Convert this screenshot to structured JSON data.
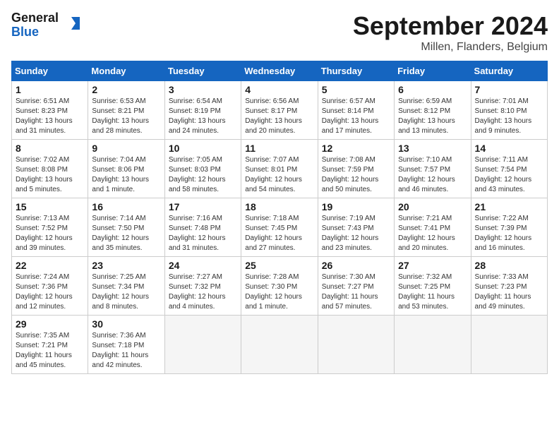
{
  "header": {
    "logo_line1": "General",
    "logo_line2": "Blue",
    "month": "September 2024",
    "location": "Millen, Flanders, Belgium"
  },
  "weekdays": [
    "Sunday",
    "Monday",
    "Tuesday",
    "Wednesday",
    "Thursday",
    "Friday",
    "Saturday"
  ],
  "weeks": [
    [
      {
        "day": "1",
        "info": "Sunrise: 6:51 AM\nSunset: 8:23 PM\nDaylight: 13 hours\nand 31 minutes."
      },
      {
        "day": "2",
        "info": "Sunrise: 6:53 AM\nSunset: 8:21 PM\nDaylight: 13 hours\nand 28 minutes."
      },
      {
        "day": "3",
        "info": "Sunrise: 6:54 AM\nSunset: 8:19 PM\nDaylight: 13 hours\nand 24 minutes."
      },
      {
        "day": "4",
        "info": "Sunrise: 6:56 AM\nSunset: 8:17 PM\nDaylight: 13 hours\nand 20 minutes."
      },
      {
        "day": "5",
        "info": "Sunrise: 6:57 AM\nSunset: 8:14 PM\nDaylight: 13 hours\nand 17 minutes."
      },
      {
        "day": "6",
        "info": "Sunrise: 6:59 AM\nSunset: 8:12 PM\nDaylight: 13 hours\nand 13 minutes."
      },
      {
        "day": "7",
        "info": "Sunrise: 7:01 AM\nSunset: 8:10 PM\nDaylight: 13 hours\nand 9 minutes."
      }
    ],
    [
      {
        "day": "8",
        "info": "Sunrise: 7:02 AM\nSunset: 8:08 PM\nDaylight: 13 hours\nand 5 minutes."
      },
      {
        "day": "9",
        "info": "Sunrise: 7:04 AM\nSunset: 8:06 PM\nDaylight: 13 hours\nand 1 minute."
      },
      {
        "day": "10",
        "info": "Sunrise: 7:05 AM\nSunset: 8:03 PM\nDaylight: 12 hours\nand 58 minutes."
      },
      {
        "day": "11",
        "info": "Sunrise: 7:07 AM\nSunset: 8:01 PM\nDaylight: 12 hours\nand 54 minutes."
      },
      {
        "day": "12",
        "info": "Sunrise: 7:08 AM\nSunset: 7:59 PM\nDaylight: 12 hours\nand 50 minutes."
      },
      {
        "day": "13",
        "info": "Sunrise: 7:10 AM\nSunset: 7:57 PM\nDaylight: 12 hours\nand 46 minutes."
      },
      {
        "day": "14",
        "info": "Sunrise: 7:11 AM\nSunset: 7:54 PM\nDaylight: 12 hours\nand 43 minutes."
      }
    ],
    [
      {
        "day": "15",
        "info": "Sunrise: 7:13 AM\nSunset: 7:52 PM\nDaylight: 12 hours\nand 39 minutes."
      },
      {
        "day": "16",
        "info": "Sunrise: 7:14 AM\nSunset: 7:50 PM\nDaylight: 12 hours\nand 35 minutes."
      },
      {
        "day": "17",
        "info": "Sunrise: 7:16 AM\nSunset: 7:48 PM\nDaylight: 12 hours\nand 31 minutes."
      },
      {
        "day": "18",
        "info": "Sunrise: 7:18 AM\nSunset: 7:45 PM\nDaylight: 12 hours\nand 27 minutes."
      },
      {
        "day": "19",
        "info": "Sunrise: 7:19 AM\nSunset: 7:43 PM\nDaylight: 12 hours\nand 23 minutes."
      },
      {
        "day": "20",
        "info": "Sunrise: 7:21 AM\nSunset: 7:41 PM\nDaylight: 12 hours\nand 20 minutes."
      },
      {
        "day": "21",
        "info": "Sunrise: 7:22 AM\nSunset: 7:39 PM\nDaylight: 12 hours\nand 16 minutes."
      }
    ],
    [
      {
        "day": "22",
        "info": "Sunrise: 7:24 AM\nSunset: 7:36 PM\nDaylight: 12 hours\nand 12 minutes."
      },
      {
        "day": "23",
        "info": "Sunrise: 7:25 AM\nSunset: 7:34 PM\nDaylight: 12 hours\nand 8 minutes."
      },
      {
        "day": "24",
        "info": "Sunrise: 7:27 AM\nSunset: 7:32 PM\nDaylight: 12 hours\nand 4 minutes."
      },
      {
        "day": "25",
        "info": "Sunrise: 7:28 AM\nSunset: 7:30 PM\nDaylight: 12 hours\nand 1 minute."
      },
      {
        "day": "26",
        "info": "Sunrise: 7:30 AM\nSunset: 7:27 PM\nDaylight: 11 hours\nand 57 minutes."
      },
      {
        "day": "27",
        "info": "Sunrise: 7:32 AM\nSunset: 7:25 PM\nDaylight: 11 hours\nand 53 minutes."
      },
      {
        "day": "28",
        "info": "Sunrise: 7:33 AM\nSunset: 7:23 PM\nDaylight: 11 hours\nand 49 minutes."
      }
    ],
    [
      {
        "day": "29",
        "info": "Sunrise: 7:35 AM\nSunset: 7:21 PM\nDaylight: 11 hours\nand 45 minutes."
      },
      {
        "day": "30",
        "info": "Sunrise: 7:36 AM\nSunset: 7:18 PM\nDaylight: 11 hours\nand 42 minutes."
      },
      {
        "day": "",
        "info": ""
      },
      {
        "day": "",
        "info": ""
      },
      {
        "day": "",
        "info": ""
      },
      {
        "day": "",
        "info": ""
      },
      {
        "day": "",
        "info": ""
      }
    ]
  ]
}
